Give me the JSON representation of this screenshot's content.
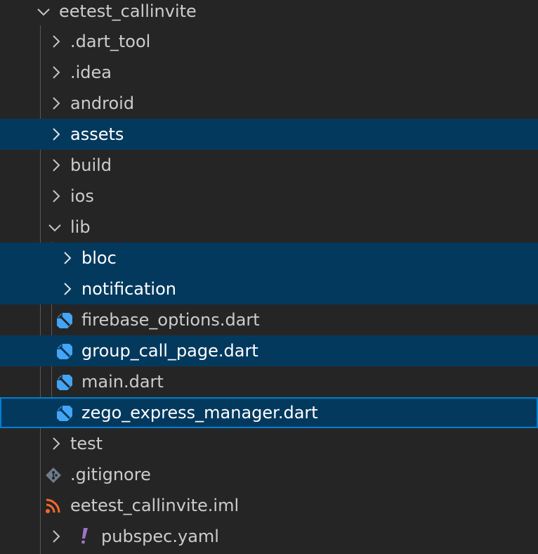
{
  "explorer": {
    "root": {
      "label": "eetest_callinvite",
      "expanded": true
    },
    "items": [
      {
        "label": ".dart_tool",
        "kind": "folder",
        "expanded": false,
        "state": "normal"
      },
      {
        "label": ".idea",
        "kind": "folder",
        "expanded": false,
        "state": "normal"
      },
      {
        "label": "android",
        "kind": "folder",
        "expanded": false,
        "state": "normal"
      },
      {
        "label": "assets",
        "kind": "folder",
        "expanded": false,
        "state": "selected"
      },
      {
        "label": "build",
        "kind": "folder",
        "expanded": false,
        "state": "normal"
      },
      {
        "label": "ios",
        "kind": "folder",
        "expanded": false,
        "state": "normal"
      },
      {
        "label": "lib",
        "kind": "folder",
        "expanded": true,
        "state": "normal"
      },
      {
        "label": "bloc",
        "kind": "folder",
        "expanded": false,
        "state": "selected"
      },
      {
        "label": "notification",
        "kind": "folder",
        "expanded": false,
        "state": "selected"
      },
      {
        "label": "firebase_options.dart",
        "kind": "dart-file",
        "state": "normal"
      },
      {
        "label": "group_call_page.dart",
        "kind": "dart-file",
        "state": "selected"
      },
      {
        "label": "main.dart",
        "kind": "dart-file",
        "state": "normal"
      },
      {
        "label": "zego_express_manager.dart",
        "kind": "dart-file",
        "state": "focused"
      },
      {
        "label": "test",
        "kind": "folder",
        "expanded": false,
        "state": "normal"
      },
      {
        "label": ".gitignore",
        "kind": "git-file",
        "state": "normal"
      },
      {
        "label": "eetest_callinvite.iml",
        "kind": "rss-file",
        "state": "normal"
      },
      {
        "label": "pubspec.yaml",
        "kind": "yaml-file",
        "expanded": false,
        "state": "normal"
      }
    ]
  },
  "colors": {
    "background": "#252526",
    "selection": "#04395e",
    "focus_border": "#007fd4",
    "dart_icon": "#42a5f5",
    "git_icon": "#6d7b8a",
    "rss_icon": "#f26a2a",
    "yaml_icon": "#a074c4"
  }
}
